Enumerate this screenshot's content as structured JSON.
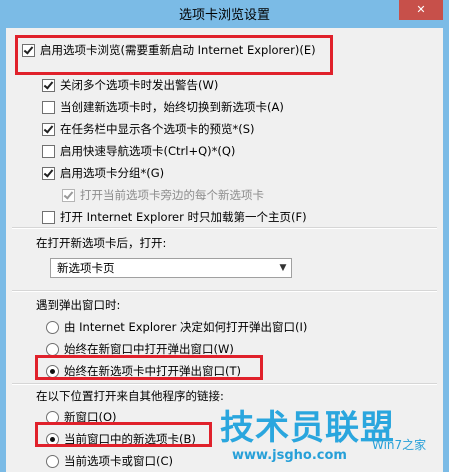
{
  "window": {
    "title": "选项卡浏览设置",
    "close_symbol": "✕"
  },
  "tabbed_browsing": {
    "enable_label": "启用选项卡浏览(需要重新启动 Internet Explorer)(E)",
    "enable_checked": true,
    "options": [
      {
        "label": "关闭多个选项卡时发出警告(W)",
        "checked": true,
        "disabled": false
      },
      {
        "label": "当创建新选项卡时，始终切换到新选项卡(A)",
        "checked": false,
        "disabled": false
      },
      {
        "label": "在任务栏中显示各个选项卡的预览*(S)",
        "checked": true,
        "disabled": false
      },
      {
        "label": "启用快速导航选项卡(Ctrl+Q)*(Q)",
        "checked": false,
        "disabled": false
      },
      {
        "label": "启用选项卡分组*(G)",
        "checked": true,
        "disabled": false
      },
      {
        "label": "打开当前选项卡旁边的每个新选项卡",
        "checked": true,
        "disabled": true
      },
      {
        "label": "打开 Internet Explorer 时只加载第一个主页(F)",
        "checked": false,
        "disabled": false
      }
    ]
  },
  "new_tab": {
    "label": "在打开新选项卡后，打开:",
    "selected": "新选项卡页"
  },
  "popups": {
    "label": "遇到弹出窗口时:",
    "options": [
      {
        "label": "由 Internet Explorer 决定如何打开弹出窗口(I)",
        "checked": false
      },
      {
        "label": "始终在新窗口中打开弹出窗口(W)",
        "checked": false
      },
      {
        "label": "始终在新选项卡中打开弹出窗口(T)",
        "checked": true
      }
    ]
  },
  "external_links": {
    "label": "在以下位置打开来自其他程序的链接:",
    "options": [
      {
        "label": "新窗口(O)",
        "checked": false
      },
      {
        "label": "当前窗口中的新选项卡(B)",
        "checked": true
      },
      {
        "label": "当前选项卡或窗口(C)",
        "checked": false
      }
    ]
  },
  "watermark": {
    "main": "技术员联盟",
    "site": "www.jsgho.com",
    "sub": "Win7之家"
  },
  "colors": {
    "highlight": "#e0212b",
    "frame": "#7bbbe6",
    "watermark": "#2aa6de"
  }
}
